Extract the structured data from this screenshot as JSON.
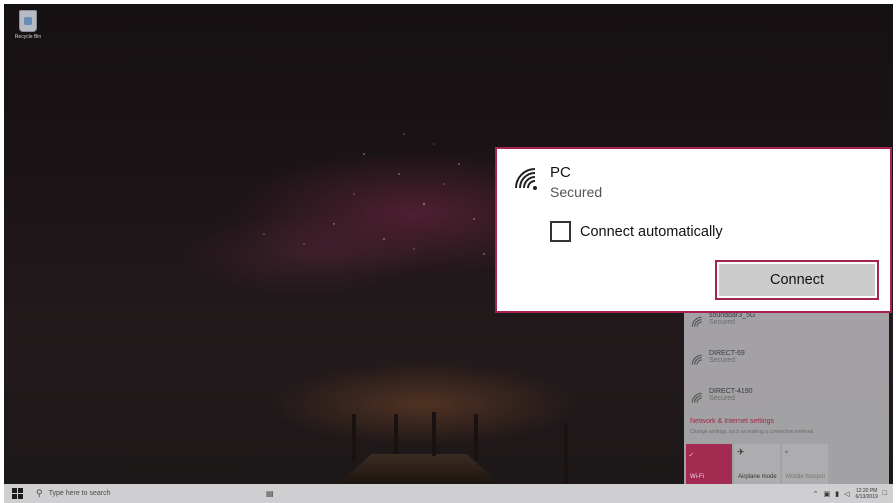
{
  "desktop": {
    "recycle_bin_label": "Recycle Bin"
  },
  "popup": {
    "network_name": "PC",
    "network_status": "Secured",
    "connect_auto_label": "Connect automatically",
    "connect_auto_checked": false,
    "connect_button_label": "Connect",
    "highlight_color": "#a5234d"
  },
  "flyout": {
    "networks": [
      {
        "name": "soundbar3_5G",
        "status": "Secured"
      },
      {
        "name": "DIRECT-69",
        "status": "Secured"
      },
      {
        "name": "DIRECT-4190",
        "status": "Secured"
      }
    ],
    "settings_link": "Network & Internet settings",
    "settings_sub": "Change settings, such as making a connection metered.",
    "tiles": [
      {
        "label": "Wi-Fi",
        "icon": "wifi-icon",
        "active": true
      },
      {
        "label": "Airplane mode",
        "icon": "airplane-icon",
        "active": false
      },
      {
        "label": "Mobile hotspot",
        "icon": "hotspot-icon",
        "active": false
      }
    ]
  },
  "taskbar": {
    "search_placeholder": "Type here to search",
    "time": "12:20 PM",
    "date": "6/13/2019"
  }
}
